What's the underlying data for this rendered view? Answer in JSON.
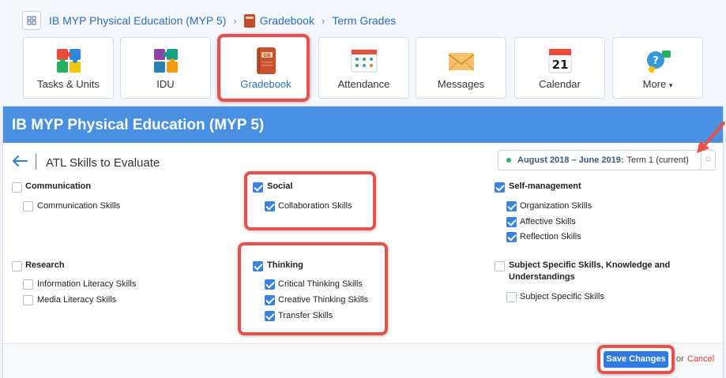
{
  "breadcrumb": {
    "course": "IB MYP Physical Education (MYP 5)",
    "section": "Gradebook",
    "page": "Term Grades"
  },
  "tabs": [
    {
      "label": "Tasks & Units",
      "icon": "puzzle-icon"
    },
    {
      "label": "IDU",
      "icon": "puzzle-multicolor-icon"
    },
    {
      "label": "Gradebook",
      "icon": "gradebook-icon",
      "active": true
    },
    {
      "label": "Attendance",
      "icon": "attendance-icon"
    },
    {
      "label": "Messages",
      "icon": "envelope-icon"
    },
    {
      "label": "Calendar",
      "icon": "calendar-icon",
      "calendar_day": "21"
    },
    {
      "label": "More",
      "icon": "more-icon"
    }
  ],
  "panel": {
    "title": "IB MYP Physical Education (MYP 5)",
    "subtitle": "ATL Skills to Evaluate",
    "term": {
      "dates": "August 2018 – June 2019:",
      "name": "Term 1 (current)"
    }
  },
  "skills": {
    "communication": {
      "label": "Communication",
      "checked": false,
      "items": [
        {
          "label": "Communication Skills",
          "checked": false
        }
      ]
    },
    "social": {
      "label": "Social",
      "checked": true,
      "items": [
        {
          "label": "Collaboration Skills",
          "checked": true
        }
      ]
    },
    "self_management": {
      "label": "Self-management",
      "checked": true,
      "items": [
        {
          "label": "Organization Skills",
          "checked": true
        },
        {
          "label": "Affective Skills",
          "checked": true
        },
        {
          "label": "Reflection Skills",
          "checked": true
        }
      ]
    },
    "research": {
      "label": "Research",
      "checked": false,
      "items": [
        {
          "label": "Information Literacy Skills",
          "checked": false
        },
        {
          "label": "Media Literacy Skills",
          "checked": false
        }
      ]
    },
    "thinking": {
      "label": "Thinking",
      "checked": true,
      "items": [
        {
          "label": "Critical Thinking Skills",
          "checked": true
        },
        {
          "label": "Creative Thinking Skills",
          "checked": true
        },
        {
          "label": "Transfer Skills",
          "checked": true
        }
      ]
    },
    "subject_specific": {
      "label_line1": "Subject Specific Skills, Knowledge and",
      "label_line2": "Understandings",
      "checked": false,
      "items": [
        {
          "label": "Subject Specific Skills",
          "checked": false
        }
      ]
    }
  },
  "footer": {
    "save_label": "Save Changes",
    "or_label": "or",
    "cancel_label": "Cancel"
  },
  "colors": {
    "header_blue": "#4a90e2",
    "link_blue": "#2f6fb8",
    "checkbox_blue": "#3b82e0",
    "highlight_red": "#e8514a",
    "cancel_red": "#e03b3b"
  }
}
